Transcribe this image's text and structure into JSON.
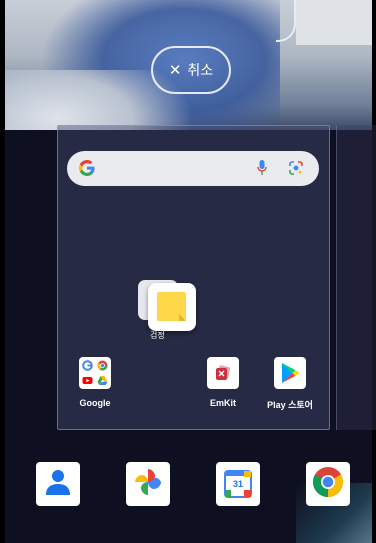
{
  "cancel": {
    "label": "취소",
    "icon": "close-icon"
  },
  "search": {
    "icons": [
      "google-g-icon",
      "mic-icon",
      "lens-icon"
    ]
  },
  "dragging_item": {
    "label": "검정",
    "icon": "note-icon"
  },
  "apps": [
    {
      "label": "Google",
      "icon": "google-folder-icon"
    },
    {
      "label": "EmKit",
      "icon": "emkit-icon"
    },
    {
      "label": "Play 스토어",
      "icon": "play-store-icon"
    }
  ],
  "dock": [
    {
      "icon": "contacts-icon"
    },
    {
      "icon": "photos-icon"
    },
    {
      "icon": "calendar-icon",
      "text": "31"
    },
    {
      "icon": "chrome-icon"
    }
  ],
  "colors": {
    "background": "#0e0f20",
    "search_bar": "#e9ebef",
    "note_yellow": "#ffd84a"
  }
}
